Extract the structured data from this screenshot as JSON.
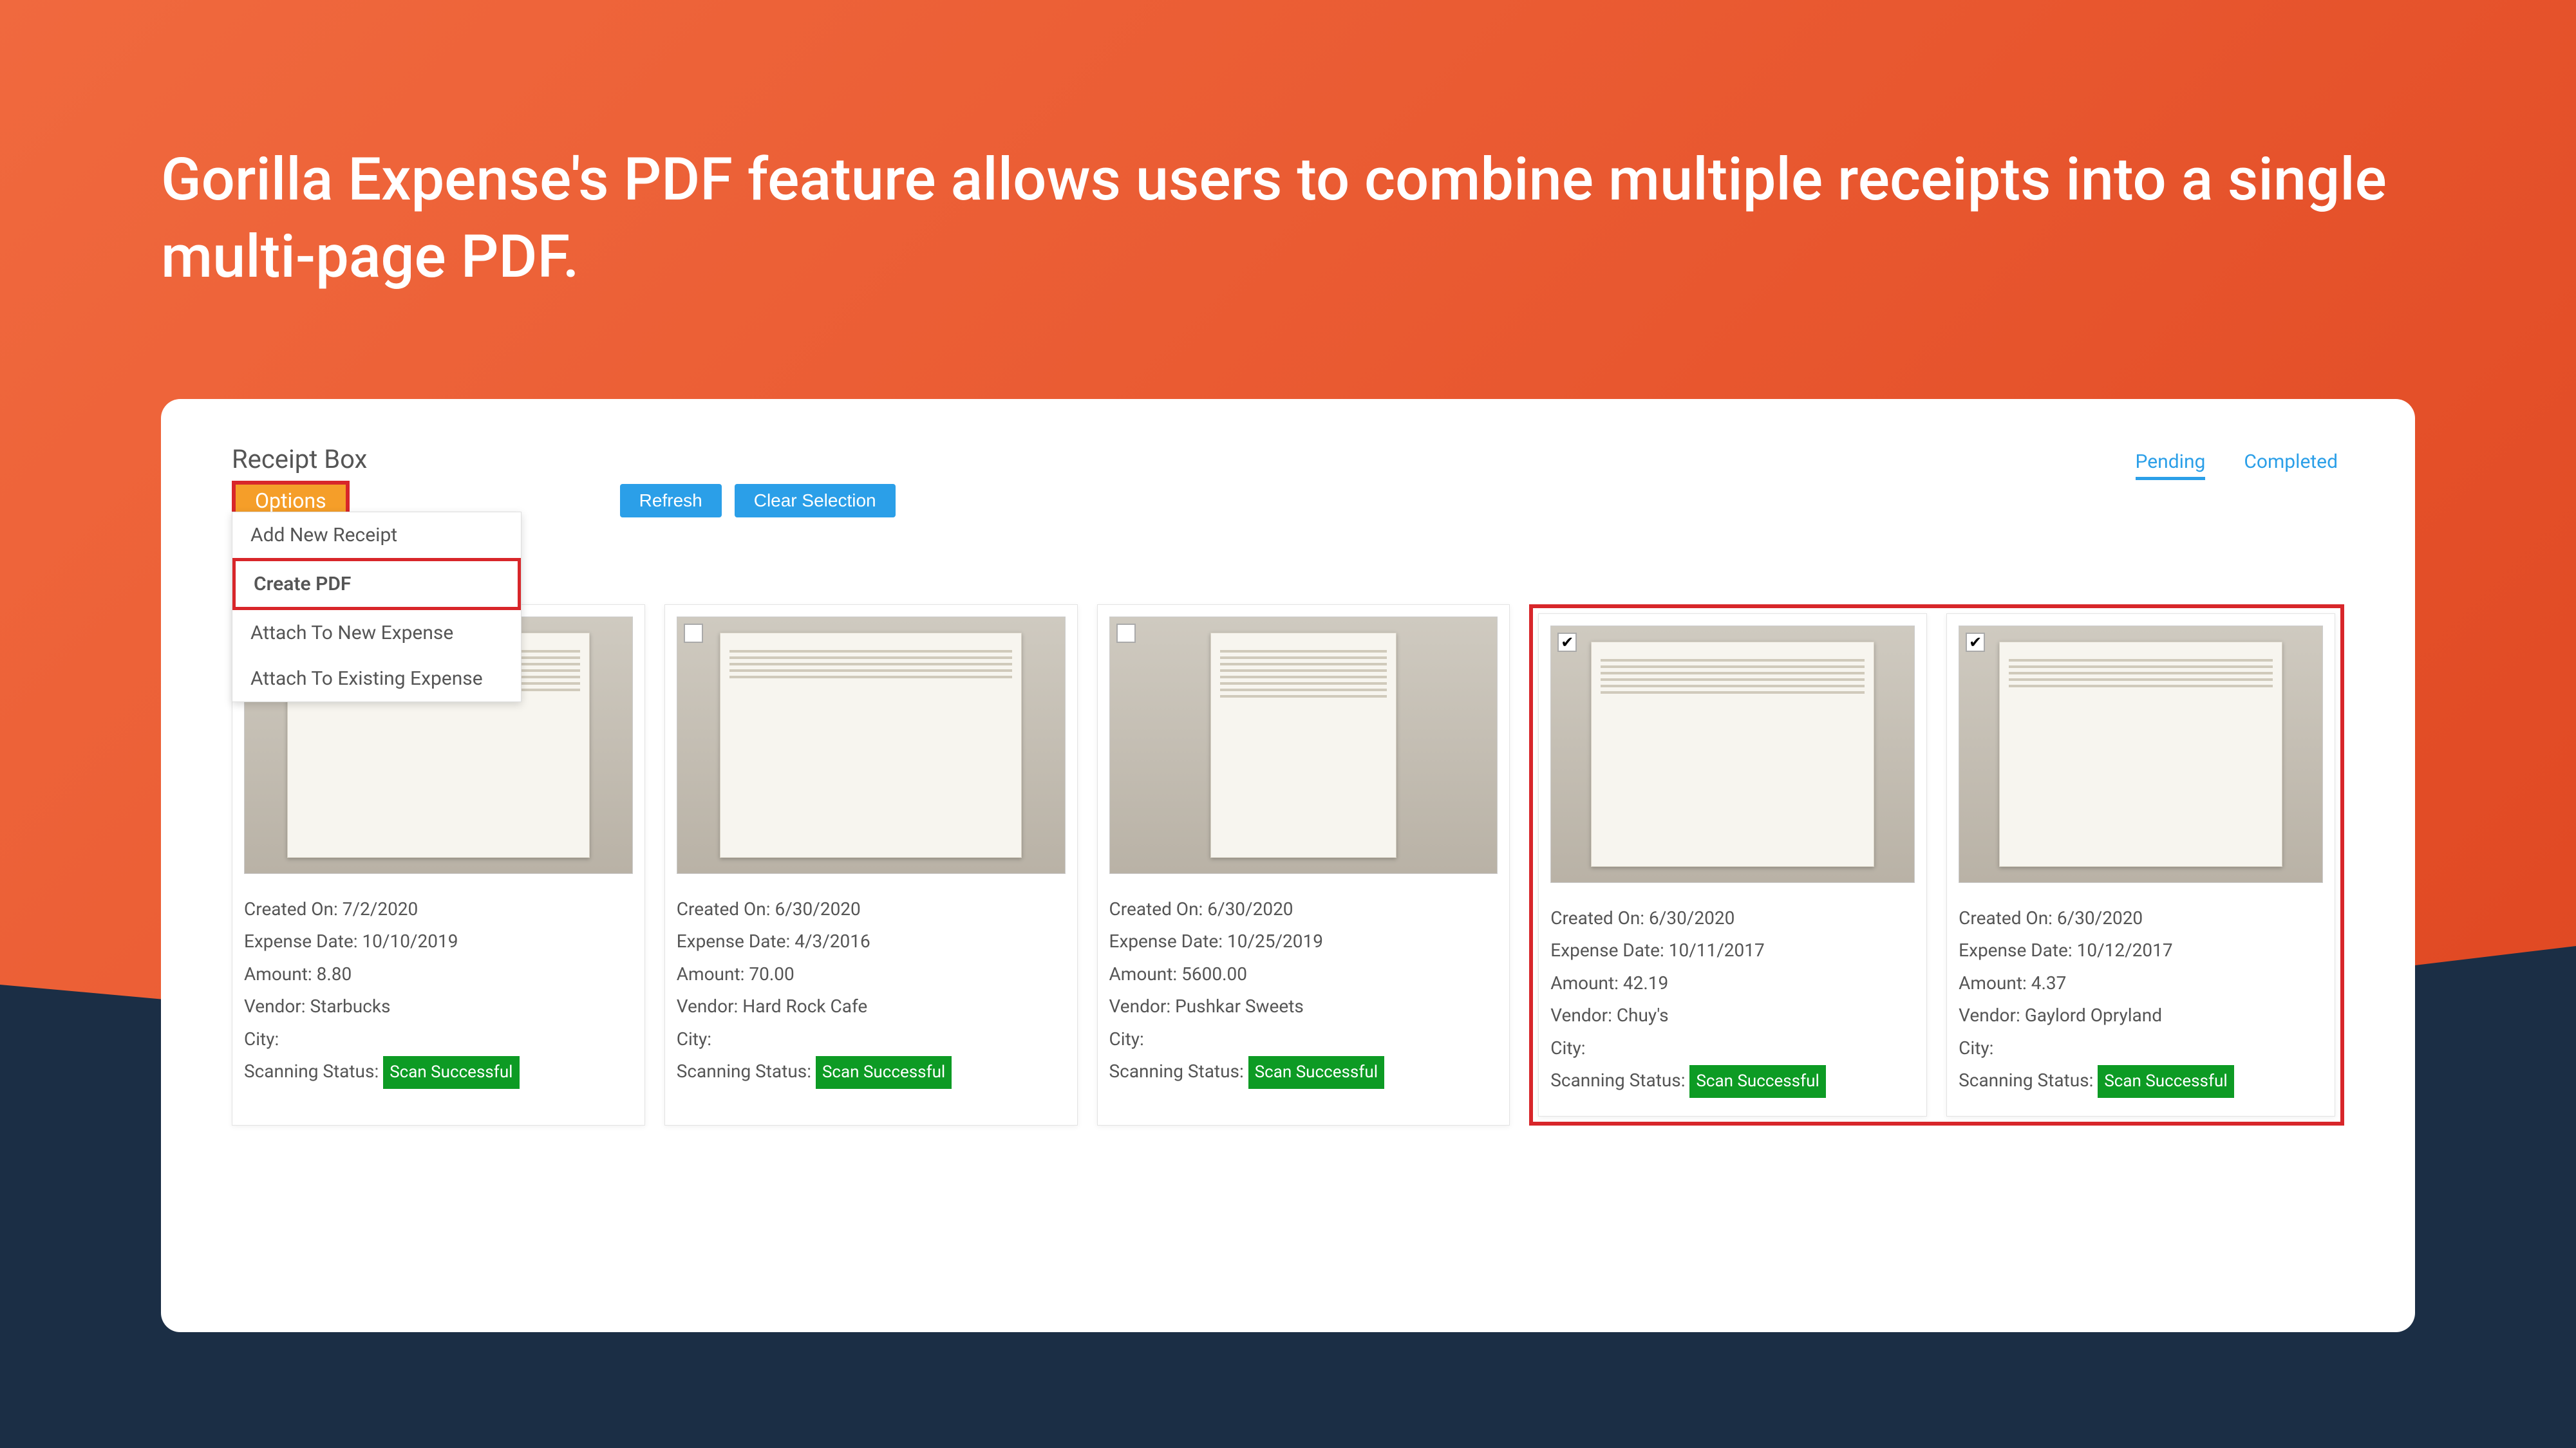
{
  "headline": "Gorilla Expense's PDF feature allows users to combine multiple receipts into a single multi-page PDF.",
  "app": {
    "title": "Receipt Box",
    "options_label": "Options",
    "dropdown": {
      "add_new": "Add New Receipt",
      "create_pdf": "Create PDF",
      "attach_new": "Attach To New Expense",
      "attach_existing": "Attach To Existing Expense"
    },
    "actions": {
      "refresh": "Refresh",
      "clear": "Clear Selection"
    },
    "tabs": {
      "pending": "Pending",
      "completed": "Completed"
    },
    "labels": {
      "created_on": "Created On:",
      "expense_date": "Expense Date:",
      "amount": "Amount:",
      "vendor": "Vendor:",
      "city": "City:",
      "scan_status": "Scanning Status:",
      "scan_success": "Scan Successful"
    },
    "receipts": [
      {
        "created": "7/2/2020",
        "date": "10/10/2019",
        "amount": "8.80",
        "vendor": "Starbucks",
        "city": "",
        "selected": false
      },
      {
        "created": "6/30/2020",
        "date": "4/3/2016",
        "amount": "70.00",
        "vendor": "Hard Rock Cafe",
        "city": "",
        "selected": false
      },
      {
        "created": "6/30/2020",
        "date": "10/25/2019",
        "amount": "5600.00",
        "vendor": "Pushkar Sweets",
        "city": "",
        "selected": false
      },
      {
        "created": "6/30/2020",
        "date": "10/11/2017",
        "amount": "42.19",
        "vendor": "Chuy's",
        "city": "",
        "selected": true
      },
      {
        "created": "6/30/2020",
        "date": "10/12/2017",
        "amount": "4.37",
        "vendor": "Gaylord Opryland",
        "city": "",
        "selected": true
      }
    ]
  }
}
